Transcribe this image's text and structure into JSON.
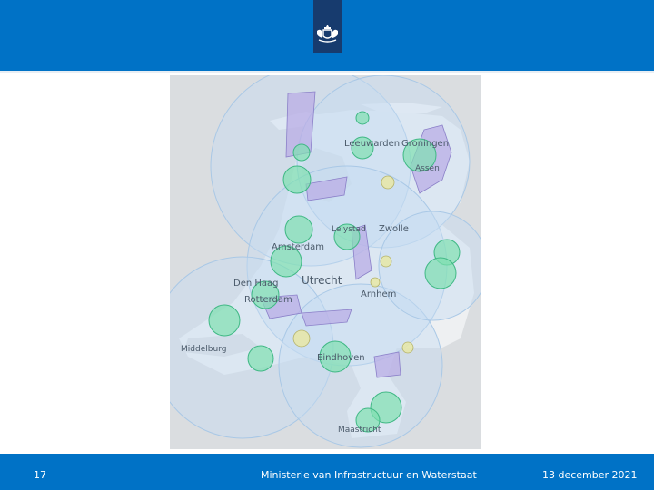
{
  "footer": {
    "page_number": "17",
    "organization": "Ministerie van Infrastructuur en Waterstaat",
    "date": "13 december 2021"
  },
  "map": {
    "labels": {
      "leeuwarden": "Leeuwarden",
      "groningen": "Groningen",
      "assen": "Assen",
      "lelystad": "Lelystad",
      "zwolle": "Zwolle",
      "amsterdam": "Amsterdam",
      "den_haag": "Den Haag",
      "rotterdam": "Rotterdam",
      "utrecht": "Utrecht",
      "arnhem": "Arnhem",
      "middelburg": "Middelburg",
      "eindhoven": "Eindhoven",
      "maastricht": "Maastricht"
    }
  },
  "colors": {
    "brand_blue": "#0072c6",
    "emblem_navy": "#173b6e",
    "zone_fill": "#cde0f2",
    "airport_green": "#7fe0b0",
    "restricted_purple": "#b9aee6"
  }
}
